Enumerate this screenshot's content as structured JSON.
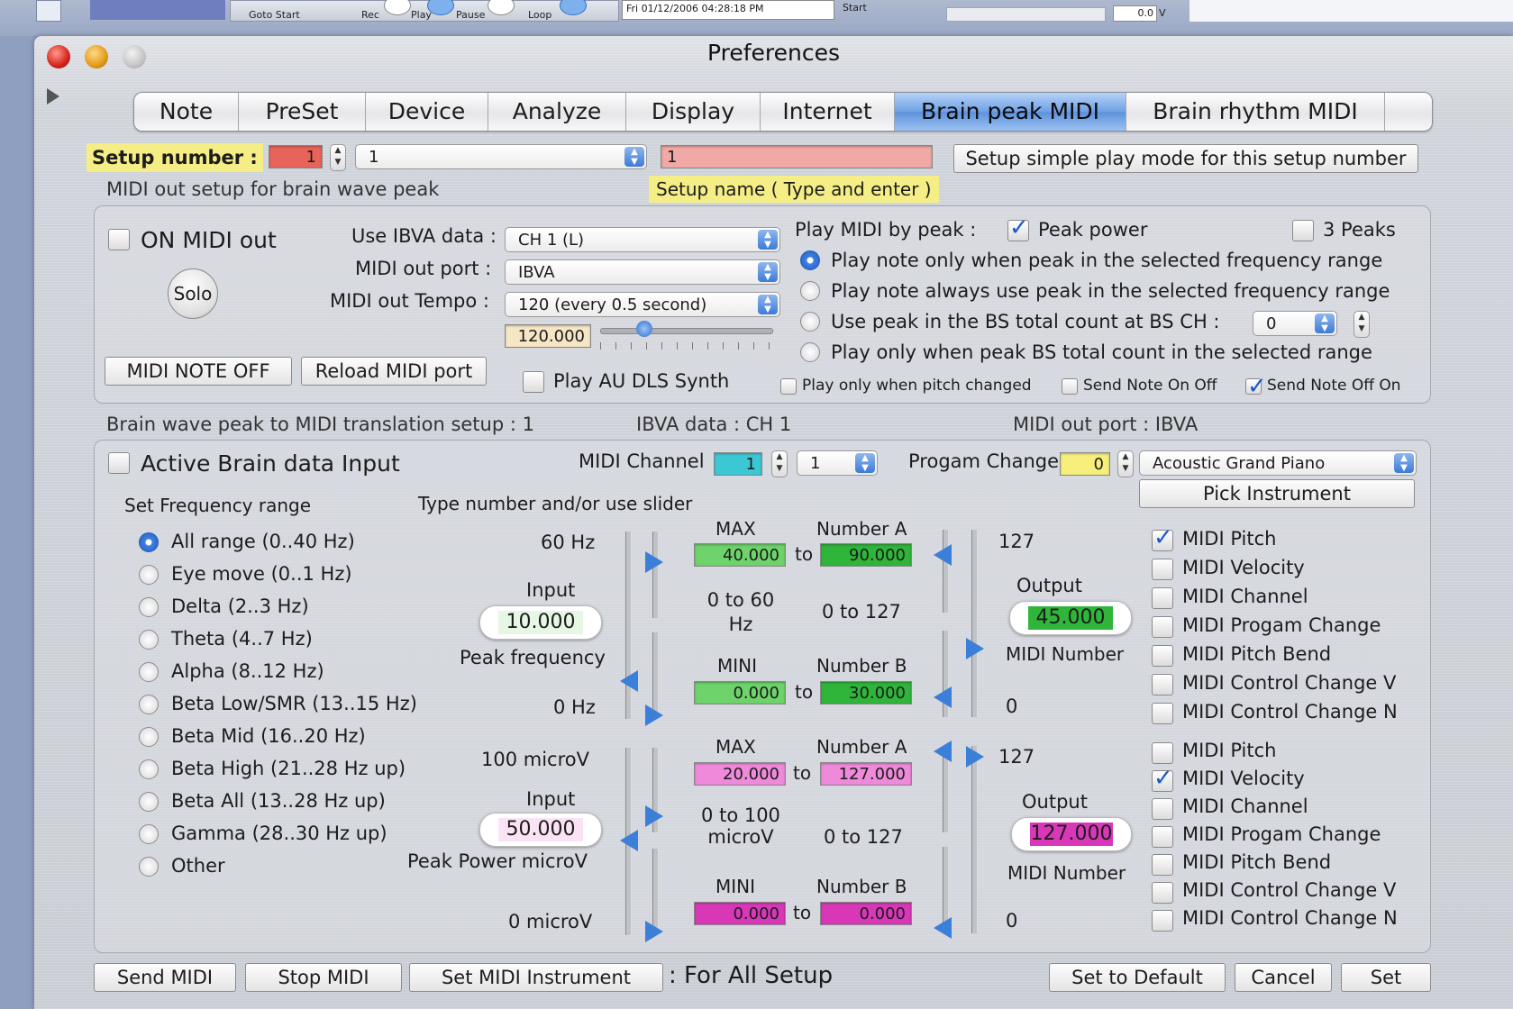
{
  "background": {
    "strip_labels": [
      "Goto Start",
      "Rec",
      "Play",
      "Pause",
      "Loop",
      "Start"
    ],
    "datetime": "Fri 01/12/2006 04:28:18 PM",
    "value": "0.0",
    "unit": "V"
  },
  "window": {
    "title": "Preferences"
  },
  "tabs": [
    {
      "label": "Note",
      "selected": false
    },
    {
      "label": "PreSet",
      "selected": false
    },
    {
      "label": "Device",
      "selected": false
    },
    {
      "label": "Analyze",
      "selected": false
    },
    {
      "label": "Display",
      "selected": false
    },
    {
      "label": "Internet",
      "selected": false
    },
    {
      "label": "Brain peak MIDI",
      "selected": true
    },
    {
      "label": "Brain rhythm MIDI",
      "selected": false
    }
  ],
  "setup": {
    "label": "Setup number :",
    "number": "1",
    "popup": "1",
    "name": "1",
    "name_hint": "Setup name ( Type and enter )",
    "simple_mode_button": "Setup simple play mode for this setup number",
    "section_caption": "MIDI out setup for brain wave peak"
  },
  "midi_out": {
    "on_label": "ON MIDI out",
    "solo": "Solo",
    "use_ibva_label": "Use IBVA data :",
    "use_ibva_value": "CH 1 (L)",
    "port_label": "MIDI out port :",
    "port_value": "IBVA",
    "tempo_label": "MIDI out Tempo :",
    "tempo_value": "120 (every 0.5 second)",
    "tempo_number": "120.000",
    "note_off_button": "MIDI NOTE OFF",
    "reload_button": "Reload MIDI port",
    "au_synth": "Play AU DLS Synth",
    "play_by_peak_label": "Play MIDI by peak :",
    "peak_power": "Peak power",
    "three_peaks": "3 Peaks",
    "options": [
      "Play note only when peak in the selected frequency range",
      "Play note always use peak in the selected frequency range",
      "Use peak in the BS total count at BS CH :",
      "Play only when peak BS total count in the selected range"
    ],
    "bs_ch_value": "0",
    "pitch_changed": "Play only when pitch changed",
    "send_on_off": "Send Note On Off",
    "send_off_on": "Send Note Off On"
  },
  "translation": {
    "caption": "Brain wave peak to MIDI translation setup : 1",
    "ibva": "IBVA data : CH 1",
    "port": "MIDI out port : IBVA"
  },
  "brain": {
    "active_label": "Active Brain data Input",
    "midi_channel_label": "MIDI Channel",
    "midi_channel_value": "1",
    "midi_channel_popup": "1",
    "program_change_label": "Progam Change",
    "program_change_value": "0",
    "instrument": "Acoustic Grand Piano",
    "pick_instrument": "Pick Instrument",
    "freq_range_label": "Set Frequency range",
    "type_hint": "Type number and/or use slider",
    "ranges": [
      "All range (0..40 Hz)",
      "Eye move (0..1 Hz)",
      "Delta (2..3 Hz)",
      "Theta (4..7 Hz)",
      "Alpha (8..12 Hz)",
      "Beta Low/SMR (13..15 Hz)",
      "Beta Mid (16..20 Hz)",
      "Beta High (21..28 Hz up)",
      "Beta All (13..28 Hz up)",
      "Gamma (28..30 Hz up)",
      "Other"
    ],
    "freq": {
      "top": "60 Hz",
      "bottom": "0 Hz",
      "input_label": "Input",
      "input_value": "10.000",
      "name": "Peak frequency",
      "max_label": "MAX",
      "max_value": "40.000",
      "numA_label": "Number A",
      "numA_value": "90.000",
      "to": "to",
      "range_in": "0 to 60 Hz",
      "range_out": "0 to 127",
      "mini_label": "MINI",
      "mini_value": "0.000",
      "numB_label": "Number B",
      "numB_value": "30.000",
      "out_top": "127",
      "out_bottom": "0",
      "output_label": "Output",
      "output_value": "45.000",
      "midi_number": "MIDI Number"
    },
    "power": {
      "top": "100 microV",
      "bottom": "0 microV",
      "input_label": "Input",
      "input_value": "50.000",
      "name": "Peak Power microV",
      "max_label": "MAX",
      "max_value": "20.000",
      "numA_label": "Number A",
      "numA_value": "127.000",
      "to": "to",
      "range_in": "0 to 100 microV",
      "range_out": "0 to 127",
      "mini_label": "MINI",
      "mini_value": "0.000",
      "numB_label": "Number B",
      "numB_value": "0.000",
      "out_top": "127",
      "out_bottom": "0",
      "output_label": "Output",
      "output_value": "127.000",
      "midi_number": "MIDI Number"
    },
    "freq_targets": [
      {
        "label": "MIDI Pitch",
        "checked": true
      },
      {
        "label": "MIDI Velocity",
        "checked": false
      },
      {
        "label": "MIDI Channel",
        "checked": false
      },
      {
        "label": "MIDI Progam Change",
        "checked": false
      },
      {
        "label": "MIDI Pitch Bend",
        "checked": false
      },
      {
        "label": "MIDI Control Change V",
        "checked": false
      },
      {
        "label": "MIDI Control Change N",
        "checked": false
      }
    ],
    "power_targets": [
      {
        "label": "MIDI Pitch",
        "checked": false
      },
      {
        "label": "MIDI Velocity",
        "checked": true
      },
      {
        "label": "MIDI Channel",
        "checked": false
      },
      {
        "label": "MIDI Progam Change",
        "checked": false
      },
      {
        "label": "MIDI Pitch Bend",
        "checked": false
      },
      {
        "label": "MIDI Control Change V",
        "checked": false
      },
      {
        "label": "MIDI Control Change N",
        "checked": false
      }
    ]
  },
  "footer": {
    "send_midi": "Send MIDI",
    "stop_midi": "Stop MIDI",
    "set_instrument": "Set MIDI Instrument",
    "for_all": ": For All Setup",
    "set_default": "Set to Default",
    "cancel": "Cancel",
    "set": "Set"
  },
  "colors": {
    "tab_selected": "#6fa1e6",
    "setup_label_bg": "#f5ee86",
    "setup_field_red": "#e8645a",
    "name_field_pink": "#f0a9a5",
    "green_field": "#6dd36a",
    "green_field_dark": "#2fb53a",
    "magenta_field": "#ee8ad9",
    "magenta_dark": "#d838b8",
    "cyan_field": "#3cc7d4",
    "yellow_field": "#f6ef7c"
  }
}
